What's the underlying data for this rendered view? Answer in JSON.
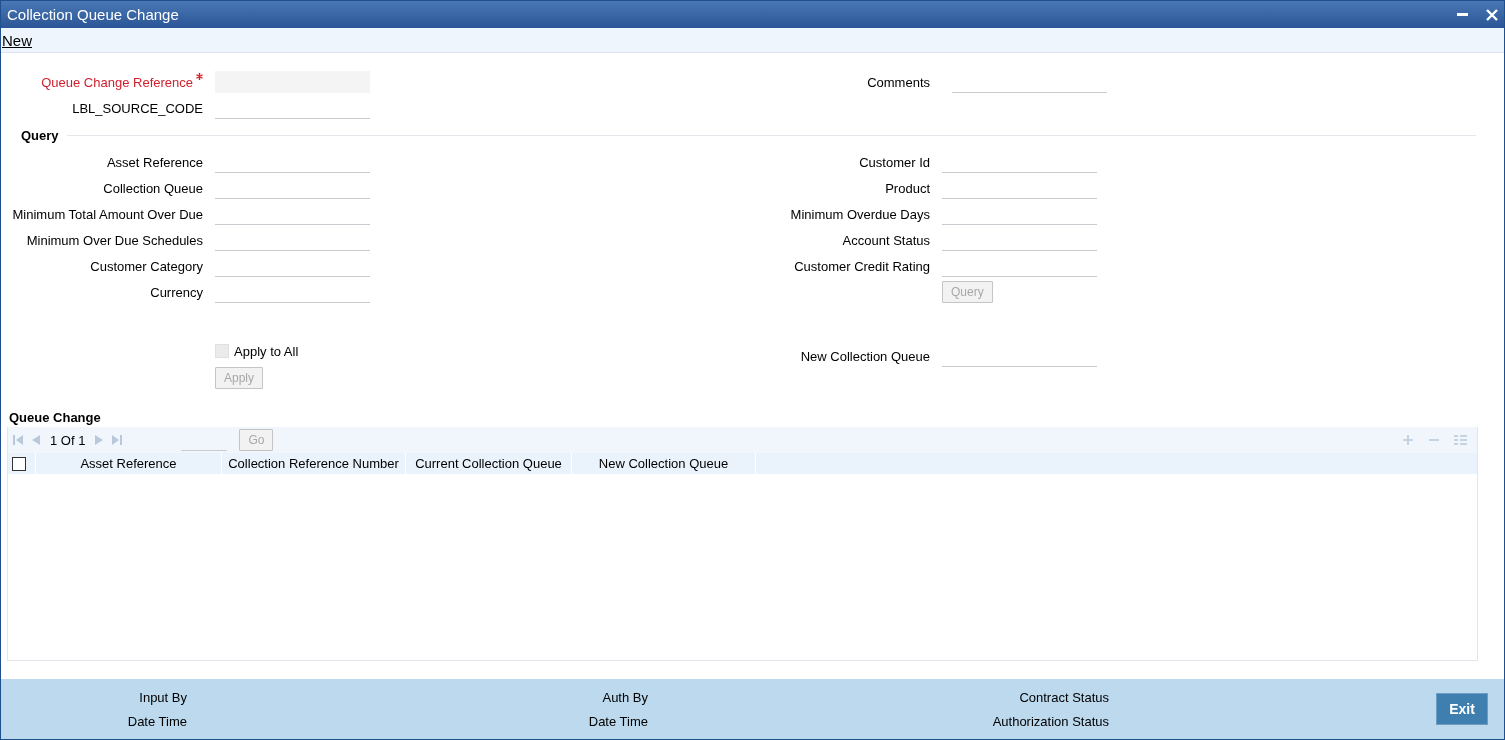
{
  "window": {
    "title": "Collection Queue Change"
  },
  "menu": [
    {
      "label": "New"
    }
  ],
  "header": {
    "left_fields": [
      {
        "label": "Queue Change Reference",
        "required": true,
        "disabled": true
      },
      {
        "label": "LBL_SOURCE_CODE",
        "required": false,
        "disabled": false
      }
    ],
    "right_fields": [
      {
        "label": "Comments",
        "required": false,
        "disabled": false
      }
    ]
  },
  "query": {
    "title": "Query",
    "left_fields": [
      {
        "label": "Asset Reference"
      },
      {
        "label": "Collection Queue"
      },
      {
        "label": "Minimum Total Amount Over Due"
      },
      {
        "label": "Minimum Over Due Schedules"
      },
      {
        "label": "Customer Category"
      },
      {
        "label": "Currency"
      }
    ],
    "right_fields": [
      {
        "label": "Customer Id"
      },
      {
        "label": "Product"
      },
      {
        "label": "Minimum Overdue Days"
      },
      {
        "label": "Account Status"
      },
      {
        "label": "Customer Credit Rating"
      }
    ],
    "button": {
      "label": "Query",
      "disabled": true
    }
  },
  "apply": {
    "checkbox": {
      "label": "Apply to All",
      "checked": false,
      "disabled": true
    },
    "button": {
      "label": "Apply",
      "disabled": true
    },
    "new_queue_field": {
      "label": "New Collection Queue"
    }
  },
  "queue_change": {
    "title": "Queue Change",
    "pager": "1 Of 1",
    "go_button": {
      "label": "Go",
      "disabled": true
    },
    "select_all": {
      "checked": false
    },
    "columns": [
      "Asset Reference",
      "Collection Reference Number",
      "Current Collection Queue",
      "New Collection Queue"
    ]
  },
  "footer": {
    "columns": [
      [
        "Input By",
        "Date Time"
      ],
      [
        "Auth By",
        "Date Time"
      ],
      [
        "Contract Status",
        "Authorization Status"
      ]
    ],
    "exit_button": "Exit"
  }
}
